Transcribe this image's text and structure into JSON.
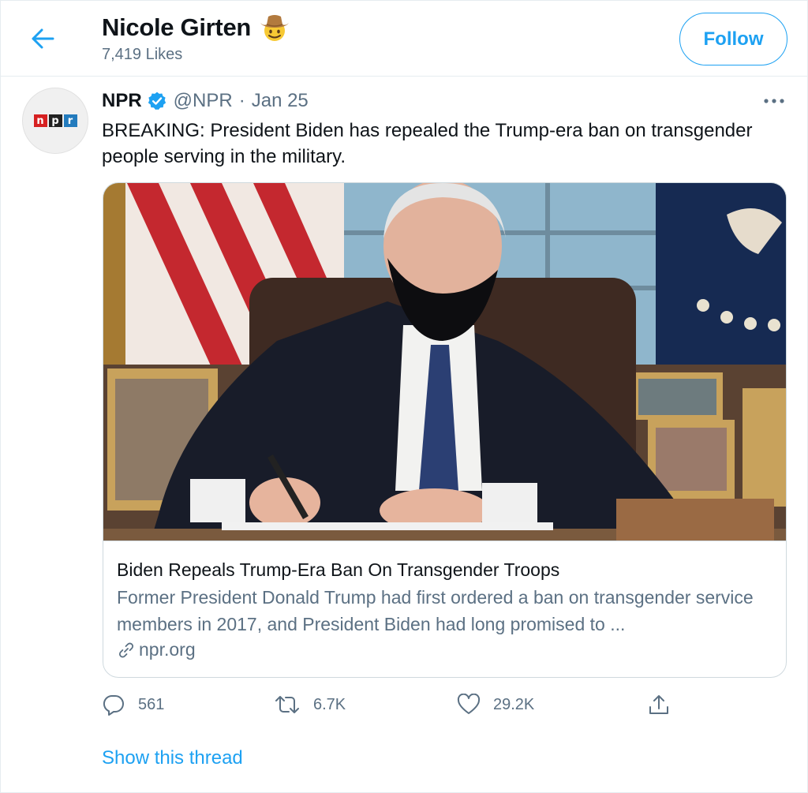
{
  "header": {
    "profile_name": "Nicole Girten",
    "name_emoji": "cowboy-face-emoji",
    "likes_count": "7,419 Likes",
    "follow_label": "Follow",
    "back_icon": "arrow-left-icon"
  },
  "tweet": {
    "author_name": "NPR",
    "verified_icon": "verified-badge-icon",
    "handle": "@NPR",
    "separator": "·",
    "date": "Jan 25",
    "avatar_logo": {
      "n": "n",
      "p": "p",
      "r": "r"
    },
    "text": "BREAKING: President Biden has repealed the Trump-era ban on transgender people serving in the military."
  },
  "card": {
    "title": "Biden Repeals Trump-Era Ban On Transgender Troops",
    "description": "Former President Donald Trump had first ordered a ban on transgender service members in 2017, and President Biden had long promised to ...",
    "domain": "npr.org",
    "image_icon": "photo-president-signing-at-desk"
  },
  "actions": {
    "reply_count": "561",
    "retweet_count": "6.7K",
    "like_count": "29.2K"
  },
  "show_thread_label": "Show this thread",
  "colors": {
    "accent": "#1da1f2",
    "muted_text": "#5b7083",
    "border": "#cfd9de"
  }
}
